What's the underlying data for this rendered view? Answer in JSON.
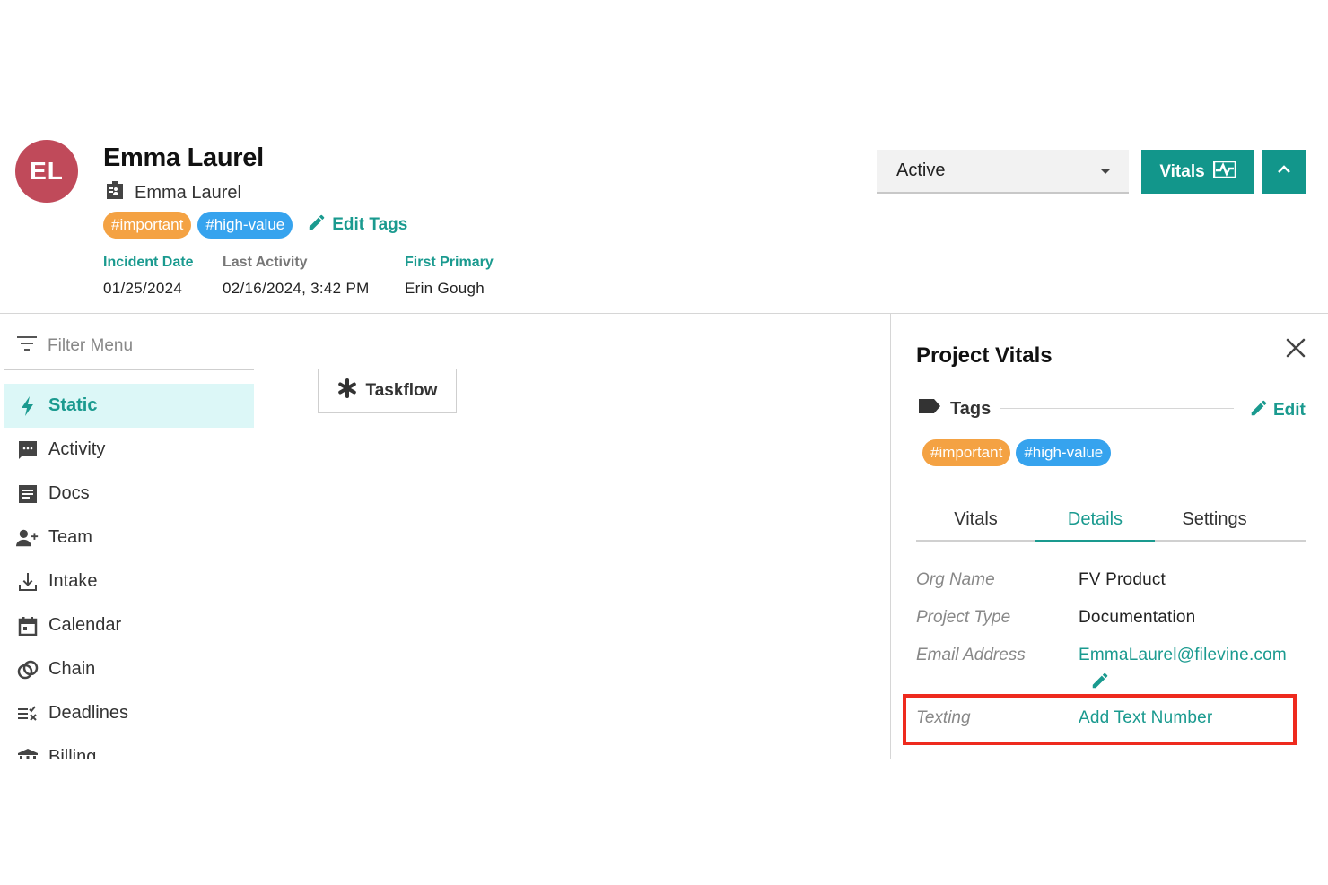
{
  "header": {
    "avatar_initials": "EL",
    "project_name": "Emma Laurel",
    "client_name": "Emma Laurel",
    "tags": [
      {
        "label": "#important",
        "color": "#f4a243"
      },
      {
        "label": "#high-value",
        "color": "#36a3ee"
      }
    ],
    "edit_tags_label": "Edit Tags",
    "meta": [
      {
        "label": "Incident Date",
        "value": "01/25/2024"
      },
      {
        "label": "Last Activity",
        "value": "02/16/2024, 3:42 PM"
      },
      {
        "label": "First Primary",
        "value": "Erin Gough"
      }
    ],
    "status_value": "Active",
    "vitals_button_label": "Vitals"
  },
  "sidebar": {
    "filter_placeholder": "Filter Menu",
    "items": [
      {
        "label": "Static",
        "icon": "bolt-icon",
        "active": true
      },
      {
        "label": "Activity",
        "icon": "chat-icon"
      },
      {
        "label": "Docs",
        "icon": "document-icon"
      },
      {
        "label": "Team",
        "icon": "add-person-icon"
      },
      {
        "label": "Intake",
        "icon": "download-icon"
      },
      {
        "label": "Calendar",
        "icon": "calendar-icon"
      },
      {
        "label": "Chain",
        "icon": "chain-icon"
      },
      {
        "label": "Deadlines",
        "icon": "checklist-icon"
      },
      {
        "label": "Billing",
        "icon": "bank-icon"
      }
    ]
  },
  "main": {
    "taskflow_label": "Taskflow"
  },
  "vitals_panel": {
    "title": "Project Vitals",
    "tags_label": "Tags",
    "edit_label": "Edit",
    "tags": [
      "#important",
      "#high-value"
    ],
    "tabs": [
      {
        "label": "Vitals"
      },
      {
        "label": "Details",
        "active": true
      },
      {
        "label": "Settings"
      }
    ],
    "fields": [
      {
        "label": "Org Name",
        "value": "FV Product"
      },
      {
        "label": "Project Type",
        "value": "Documentation"
      },
      {
        "label": "Email Address",
        "value": "EmmaLaurel@filevine.com"
      },
      {
        "label": "Texting",
        "value": "Add Text Number"
      }
    ],
    "highlight_color": "#ee2a1e"
  },
  "accent_color": "#12968b"
}
